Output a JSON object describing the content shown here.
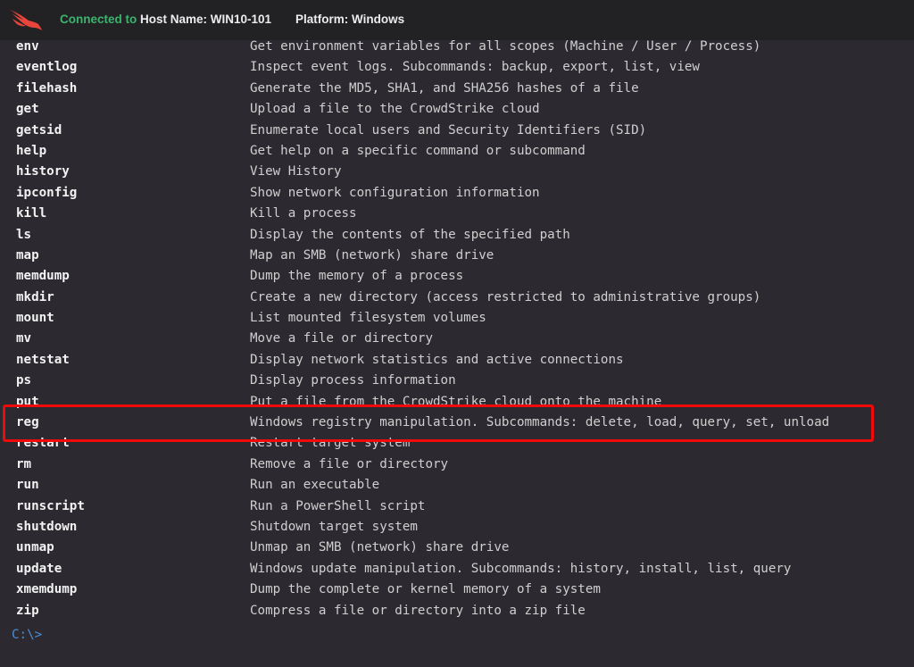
{
  "header": {
    "logo_icon": "crowdstrike-falcon-icon",
    "connected_label": "Connected to",
    "host_label": "Host Name: WIN10-101",
    "platform_label": "Platform: Windows",
    "colors": {
      "connected": "#3cb46e",
      "logo": "#e8453c"
    }
  },
  "terminal": {
    "commands": [
      {
        "name": "env",
        "description": "Get environment variables for all scopes (Machine / User / Process)"
      },
      {
        "name": "eventlog",
        "description": "Inspect event logs. Subcommands: backup, export, list, view"
      },
      {
        "name": "filehash",
        "description": "Generate the MD5, SHA1, and SHA256 hashes of a file"
      },
      {
        "name": "get",
        "description": "Upload a file to the CrowdStrike cloud"
      },
      {
        "name": "getsid",
        "description": "Enumerate local users and Security Identifiers (SID)"
      },
      {
        "name": "help",
        "description": "Get help on a specific command or subcommand"
      },
      {
        "name": "history",
        "description": "View History"
      },
      {
        "name": "ipconfig",
        "description": "Show network configuration information"
      },
      {
        "name": "kill",
        "description": "Kill a process"
      },
      {
        "name": "ls",
        "description": "Display the contents of the specified path"
      },
      {
        "name": "map",
        "description": "Map an SMB (network) share drive"
      },
      {
        "name": "memdump",
        "description": "Dump the memory of a process"
      },
      {
        "name": "mkdir",
        "description": "Create a new directory (access restricted to administrative groups)"
      },
      {
        "name": "mount",
        "description": "List mounted filesystem volumes"
      },
      {
        "name": "mv",
        "description": "Move a file or directory"
      },
      {
        "name": "netstat",
        "description": "Display network statistics and active connections"
      },
      {
        "name": "ps",
        "description": "Display process information"
      },
      {
        "name": "put",
        "description": "Put a file from the CrowdStrike cloud onto the machine"
      },
      {
        "name": "reg",
        "description": "Windows registry manipulation. Subcommands: delete, load, query, set, unload",
        "highlighted": true
      },
      {
        "name": "restart",
        "description": "Restart target system"
      },
      {
        "name": "rm",
        "description": "Remove a file or directory"
      },
      {
        "name": "run",
        "description": "Run an executable"
      },
      {
        "name": "runscript",
        "description": "Run a PowerShell script"
      },
      {
        "name": "shutdown",
        "description": "Shutdown target system"
      },
      {
        "name": "unmap",
        "description": "Unmap an SMB (network) share drive"
      },
      {
        "name": "update",
        "description": "Windows update manipulation. Subcommands: history, install, list, query"
      },
      {
        "name": "xmemdump",
        "description": "Dump the complete or kernel memory of a system"
      },
      {
        "name": "zip",
        "description": "Compress a file or directory into a zip file"
      }
    ],
    "prompt": "C:\\>",
    "highlight_color": "#f00a0a"
  }
}
